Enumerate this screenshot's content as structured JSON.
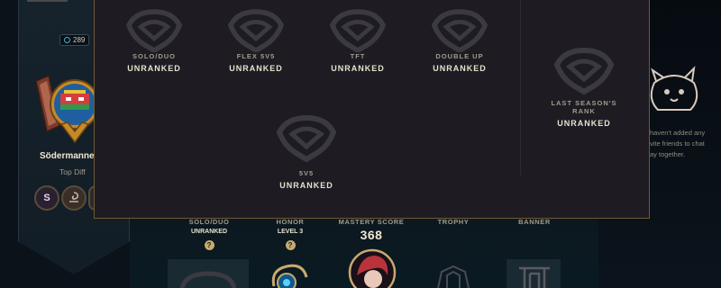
{
  "wallet": {
    "amount": "289",
    "icon": "blue-essence-icon"
  },
  "profile": {
    "name": "Södermanner",
    "title": "Top Diff",
    "emblems": [
      {
        "label": "S",
        "icon": "season-emblem-icon"
      },
      {
        "label": "",
        "icon": "mastery-emblem-icon"
      }
    ]
  },
  "ranked_modal": {
    "queues": [
      {
        "name": "SOLO/DUO",
        "rank": "UNRANKED"
      },
      {
        "name": "FLEX 5V5",
        "rank": "UNRANKED"
      },
      {
        "name": "TFT",
        "rank": "UNRANKED"
      },
      {
        "name": "DOUBLE UP",
        "rank": "UNRANKED"
      },
      {
        "name": "5V5",
        "rank": "UNRANKED"
      }
    ],
    "last_season": {
      "name": "LAST SEASON'S RANK",
      "rank": "UNRANKED"
    }
  },
  "friends_panel": {
    "line1": "haven't added any",
    "line2": "vite friends to chat",
    "line3": "ay together."
  },
  "stats": {
    "solo_duo": {
      "label": "SOLO/DUO",
      "sub": "UNRANKED",
      "help": "?"
    },
    "honor": {
      "label": "HONOR",
      "sub": "LEVEL 3",
      "help": "?"
    },
    "mastery": {
      "label": "MASTERY SCORE",
      "value": "368"
    },
    "trophy": {
      "label": "TROPHY"
    },
    "banner": {
      "label": "BANNER"
    }
  },
  "colors": {
    "accent_gold": "#c8aa6e",
    "modal_bg": "#1e1c22",
    "modal_border": "#6e5a36"
  }
}
